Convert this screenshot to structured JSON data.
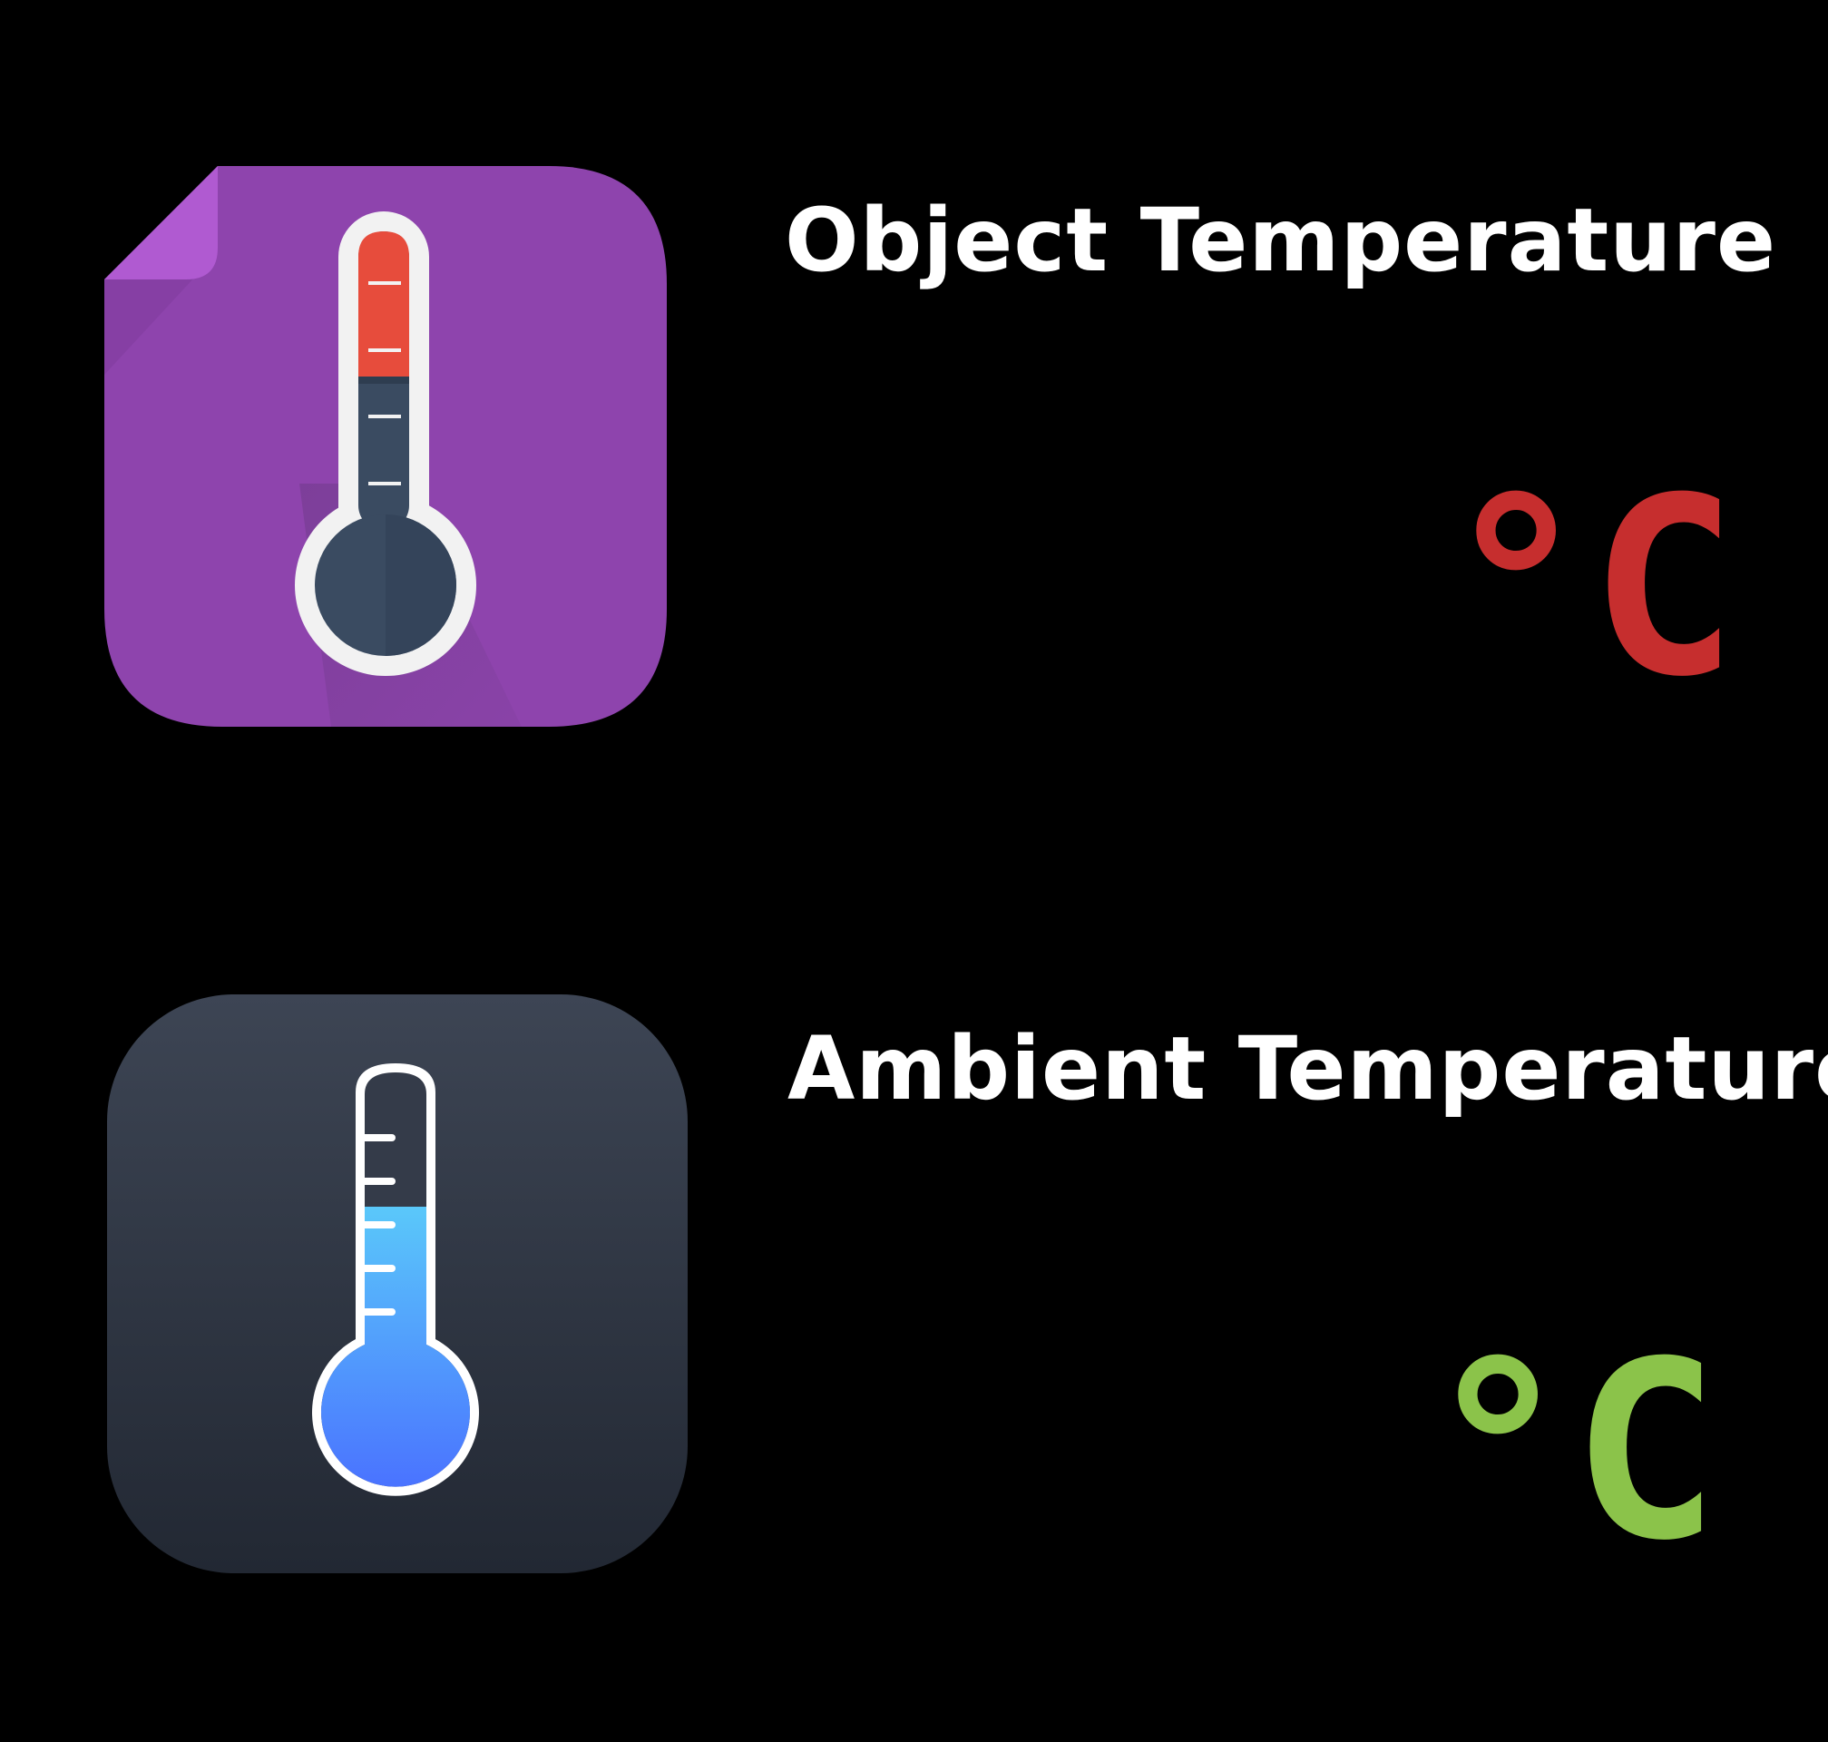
{
  "object_panel": {
    "icon": "thermometer-hot-icon",
    "label": "Object Temperature",
    "unit": "°C",
    "unit_color": "#c62e2e",
    "icon_bg_color": "#8e44ad"
  },
  "ambient_panel": {
    "icon": "thermometer-cold-icon",
    "label": "Ambient Temperature",
    "unit": "°C",
    "unit_color": "#8bc34a",
    "icon_bg_color": "#2c3442"
  }
}
